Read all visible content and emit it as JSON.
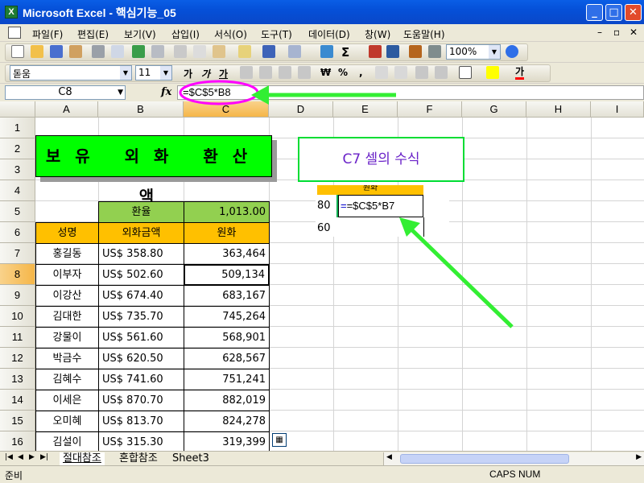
{
  "window": {
    "title": "Microsoft Excel - 핵심기능_05",
    "app_icon": "X"
  },
  "menu": {
    "items": [
      "파일(F)",
      "편집(E)",
      "보기(V)",
      "삽입(I)",
      "서식(O)",
      "도구(T)",
      "데이터(D)",
      "창(W)",
      "도움말(H)"
    ]
  },
  "toolbar": {
    "zoom": "100%",
    "font_name": "돋움",
    "font_size": "11",
    "currency_symbol": "₩",
    "percent_symbol": "%"
  },
  "formula_bar": {
    "name_box": "C8",
    "fx": "fx",
    "formula": "=$C$5*B8"
  },
  "columns": [
    "A",
    "B",
    "C",
    "D",
    "E",
    "F",
    "G",
    "H",
    "I"
  ],
  "rows": [
    "1",
    "2",
    "3",
    "4",
    "5",
    "6",
    "7",
    "8",
    "9",
    "10",
    "11",
    "12",
    "13",
    "14",
    "15",
    "16"
  ],
  "sheet": {
    "title": "보유 외화 환산액",
    "rate_label": "환율",
    "rate_value": "1,013.00",
    "headers": [
      "성명",
      "외화금액",
      "원화"
    ],
    "records": [
      [
        "홍길동",
        "US$  358.80",
        "363,464"
      ],
      [
        "이부자",
        "US$  502.60",
        "509,134"
      ],
      [
        "이강산",
        "US$  674.40",
        "683,167"
      ],
      [
        "김대한",
        "US$  735.70",
        "745,264"
      ],
      [
        "강물이",
        "US$  561.60",
        "568,901"
      ],
      [
        "박금수",
        "US$  620.50",
        "628,567"
      ],
      [
        "김혜수",
        "US$  741.60",
        "751,241"
      ],
      [
        "이세은",
        "US$  870.70",
        "882,019"
      ],
      [
        "오미혜",
        "US$  813.70",
        "824,278"
      ],
      [
        "김설이",
        "US$  315.30",
        "319,399"
      ]
    ]
  },
  "annotation": {
    "label": "C7 셀의 수식",
    "inset_header": "원화",
    "inset_formula": "=$C$5*B7",
    "inset_left_top": "80",
    "inset_left_bottom": "60"
  },
  "tabs": [
    "절대참조",
    "혼합참조",
    "Sheet3"
  ],
  "status": {
    "ready": "준비",
    "indicators": "CAPS NUM"
  },
  "colors": {
    "title_fill": "#00ff00",
    "header_fill": "#ffc000",
    "rate_fill": "#92d050",
    "highlight": "#ff00ff",
    "arrow": "#33ee33"
  }
}
